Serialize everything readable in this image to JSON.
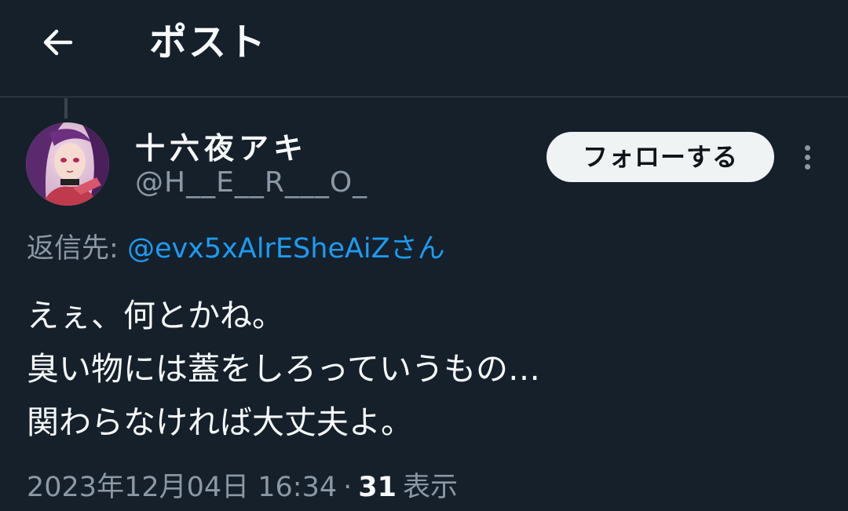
{
  "header": {
    "back_icon": "arrow-left-icon",
    "title": "ポスト"
  },
  "author": {
    "display_name": "十六夜アキ",
    "handle": "@H__E__R___O_",
    "avatar_icon": "avatar-anime-character"
  },
  "actions": {
    "follow_label": "フォローする",
    "more_icon": "more-vertical-icon"
  },
  "reply": {
    "prefix": "返信先:",
    "mention": "@evx5xAlrESheAiZさん"
  },
  "post": {
    "lines": [
      "えぇ、何とかね。",
      "臭い物には蓋をしろっていうもの…",
      "関わらなければ大丈夫よ。"
    ]
  },
  "meta": {
    "timestamp": "2023年12月04日 16:34",
    "separator": "·",
    "views_count": "31",
    "views_label": "表示"
  },
  "colors": {
    "background": "#15202b",
    "text": "#f7f9f9",
    "secondary_text": "#8b98a5",
    "link": "#1d9bf0",
    "divider": "#38444d",
    "follow_button_bg": "#eff3f4"
  }
}
